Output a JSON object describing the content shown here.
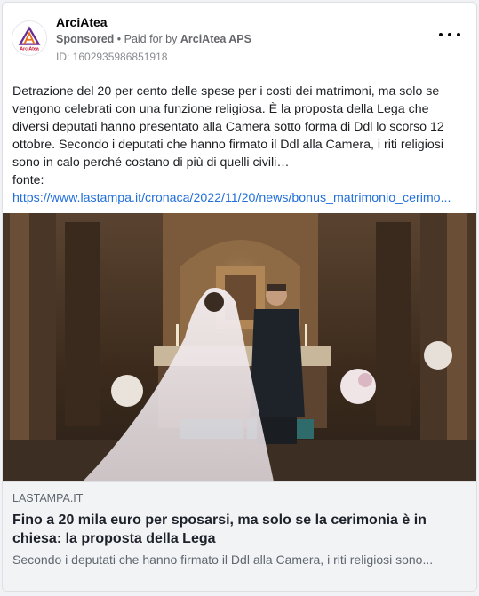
{
  "post": {
    "page_name": "ArciAtea",
    "sponsored_label": "Sponsored",
    "paid_for_prefix": " • Paid for by ",
    "payer": "ArciAtea APS",
    "ad_id": "ID: 1602935986851918",
    "logo_text": "ArciAtea",
    "more_icon": "more-horizontal-icon",
    "body": {
      "paragraph_1": "Detrazione del 20 per cento delle spese per i costi dei matrimoni, ma solo se vengono celebrati con una funzione religiosa. È la proposta della Lega che diversi deputati hanno presentato alla Camera sotto forma di Ddl lo scorso 12 ottobre. Secondo i deputati che hanno firmato il Ddl alla Camera, i riti religiosi sono in calo perché costano di più di quelli civili…",
      "source_label": "fonte:",
      "source_url": "https://www.lastampa.it/cronaca/2022/11/20/news/bonus_matrimonio_cerimo..."
    }
  },
  "link_preview": {
    "domain": "LASTAMPA.IT",
    "title": "Fino a 20 mila euro per sposarsi, ma solo se la cerimonia è in chiesa: la proposta della Lega",
    "description": "Secondo i deputati che hanno firmato il Ddl alla Camera, i riti religiosi sono..."
  },
  "colors": {
    "link": "#216fdb",
    "secondary_text": "#65676b",
    "logo_red": "#c8102e",
    "logo_purple": "#6b2c91"
  }
}
